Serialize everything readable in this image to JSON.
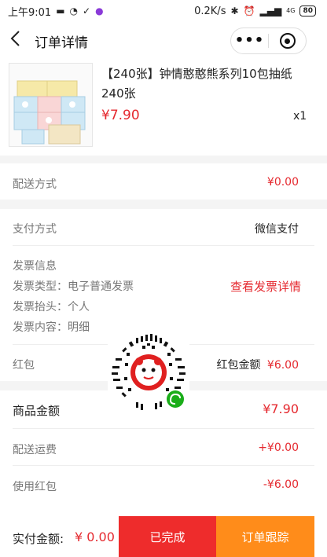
{
  "status_bar": {
    "time": "上午9:01",
    "speed": "0.2K/s",
    "network": "4G",
    "battery": "80"
  },
  "nav": {
    "title": "订单详情",
    "more_label": "•••"
  },
  "product": {
    "title": "【240张】钟情憨憨熊系列10包抽纸240张",
    "price": "¥7.90",
    "quantity": "x1"
  },
  "delivery": {
    "label": "配送方式",
    "value": "¥0.00"
  },
  "payment": {
    "label": "支付方式",
    "value": "微信支付"
  },
  "invoice": {
    "title": "发票信息",
    "type": "发票类型：电子普通发票",
    "header": "发票抬头：个人",
    "content": "发票内容：明细",
    "link": "查看发票详情"
  },
  "red_packet": {
    "label": "红包",
    "value_label": "红包金额",
    "value": "¥6.00"
  },
  "summary": {
    "goods_label": "商品金额",
    "goods_value": "¥7.90",
    "shipping_label": "配送运费",
    "shipping_value": "+¥0.00",
    "packet_label": "使用红包",
    "packet_value": "-¥6.00"
  },
  "footer": {
    "paid_label": "实付金额:",
    "paid_value": "¥ 0.00",
    "done_label": "已完成",
    "track_label": "订单跟踪"
  },
  "colors": {
    "accent_red": "#e5292f",
    "button_red": "#ee2c2c",
    "button_orange": "#ff8c1a",
    "wechat_green": "#1aad19"
  }
}
